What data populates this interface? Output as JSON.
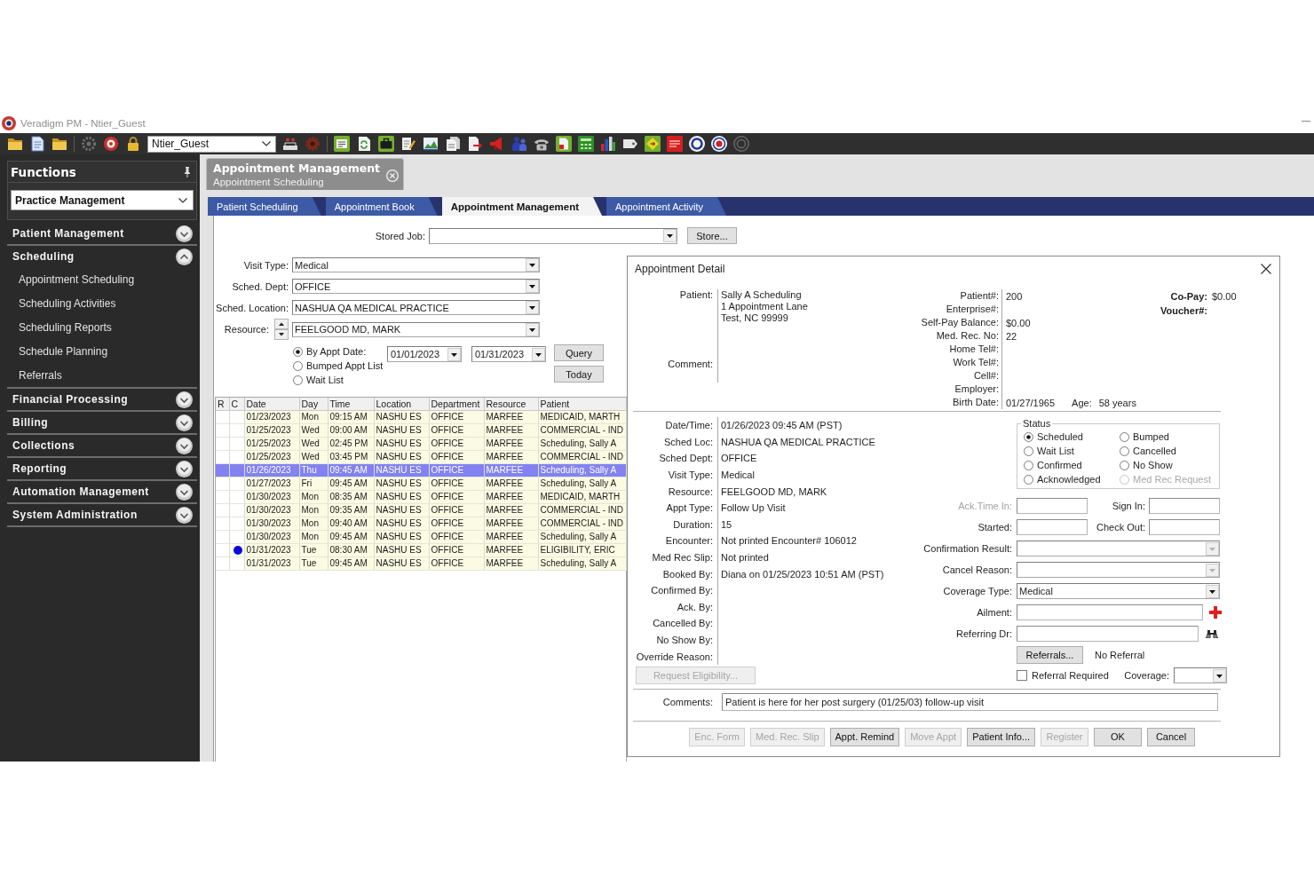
{
  "window": {
    "title": "Veradigm PM - Ntier_Guest"
  },
  "toolbar": {
    "user": "Ntier_Guest"
  },
  "sidebar": {
    "title": "Functions",
    "module": "Practice Management",
    "sections": [
      {
        "label": "Patient Management",
        "expanded": false
      },
      {
        "label": "Scheduling",
        "expanded": true,
        "items": [
          {
            "label": "Appointment Scheduling"
          },
          {
            "label": "Scheduling Activities"
          },
          {
            "label": "Scheduling Reports"
          },
          {
            "label": "Schedule Planning"
          },
          {
            "label": "Referrals"
          }
        ]
      },
      {
        "label": "Financial Processing",
        "expanded": false
      },
      {
        "label": "Billing",
        "expanded": false
      },
      {
        "label": "Collections",
        "expanded": false
      },
      {
        "label": "Reporting",
        "expanded": false
      },
      {
        "label": "Automation Management",
        "expanded": false
      },
      {
        "label": "System Administration",
        "expanded": false
      }
    ]
  },
  "document_tab": {
    "title": "Appointment Management",
    "subtitle": "Appointment Scheduling"
  },
  "tabs": [
    {
      "label": "Patient Scheduling",
      "selected": false
    },
    {
      "label": "Appointment Book",
      "selected": false
    },
    {
      "label": "Appointment Management",
      "selected": true
    },
    {
      "label": "Appointment Activity",
      "selected": false
    }
  ],
  "search_form": {
    "stored_job": {
      "label": "Stored Job:"
    },
    "store_button": "Store...",
    "fields": [
      {
        "label": "Visit Type:",
        "value": "Medical",
        "kind": "select"
      },
      {
        "label": "Sched. Dept:",
        "value": "OFFICE",
        "kind": "select"
      },
      {
        "label": "Sched. Location:",
        "value": "NASHUA QA MEDICAL PRACTICE",
        "kind": "select"
      },
      {
        "label": "Resource:",
        "value": "FEELGOOD MD, MARK",
        "kind": "spinner_select"
      }
    ],
    "modes": [
      {
        "label": "By Appt Date:",
        "selected": true
      },
      {
        "label": "Bumped Appt List",
        "selected": false
      },
      {
        "label": "Wait List",
        "selected": false
      }
    ],
    "date_from": "01/01/2023",
    "date_to": "01/31/2023",
    "buttons": [
      "Query",
      "Today"
    ]
  },
  "table": {
    "columns": [
      "R",
      "C",
      "Date",
      "Day",
      "Time",
      "Location",
      "Department",
      "Resource",
      "Patient"
    ],
    "rows": [
      {
        "date": "01/23/2023",
        "day": "Mon",
        "time": "09:15 AM",
        "location": "NASHU ES",
        "department": "OFFICE",
        "resource": "MARFEE",
        "patient": "MEDICAID, MARTH",
        "selected": false,
        "dot": false
      },
      {
        "date": "01/25/2023",
        "day": "Wed",
        "time": "09:00 AM",
        "location": "NASHU ES",
        "department": "OFFICE",
        "resource": "MARFEE",
        "patient": "COMMERCIAL - IND",
        "selected": false,
        "dot": false
      },
      {
        "date": "01/25/2023",
        "day": "Wed",
        "time": "02:45 PM",
        "location": "NASHU ES",
        "department": "OFFICE",
        "resource": "MARFEE",
        "patient": "Scheduling, Sally A",
        "selected": false,
        "dot": false
      },
      {
        "date": "01/25/2023",
        "day": "Wed",
        "time": "03:45 PM",
        "location": "NASHU ES",
        "department": "OFFICE",
        "resource": "MARFEE",
        "patient": "COMMERCIAL - IND",
        "selected": false,
        "dot": false
      },
      {
        "date": "01/26/2023",
        "day": "Thu",
        "time": "09:45 AM",
        "location": "NASHU ES",
        "department": "OFFICE",
        "resource": "MARFEE",
        "patient": "Scheduling, Sally A",
        "selected": true,
        "dot": false
      },
      {
        "date": "01/27/2023",
        "day": "Fri",
        "time": "09:45 AM",
        "location": "NASHU ES",
        "department": "OFFICE",
        "resource": "MARFEE",
        "patient": "Scheduling, Sally A",
        "selected": false,
        "dot": false
      },
      {
        "date": "01/30/2023",
        "day": "Mon",
        "time": "08:35 AM",
        "location": "NASHU ES",
        "department": "OFFICE",
        "resource": "MARFEE",
        "patient": "MEDICAID, MARTH",
        "selected": false,
        "dot": false
      },
      {
        "date": "01/30/2023",
        "day": "Mon",
        "time": "09:35 AM",
        "location": "NASHU ES",
        "department": "OFFICE",
        "resource": "MARFEE",
        "patient": "COMMERCIAL - IND",
        "selected": false,
        "dot": false
      },
      {
        "date": "01/30/2023",
        "day": "Mon",
        "time": "09:40 AM",
        "location": "NASHU ES",
        "department": "OFFICE",
        "resource": "MARFEE",
        "patient": "COMMERCIAL - IND",
        "selected": false,
        "dot": false
      },
      {
        "date": "01/30/2023",
        "day": "Mon",
        "time": "09:45 AM",
        "location": "NASHU ES",
        "department": "OFFICE",
        "resource": "MARFEE",
        "patient": "Scheduling, Sally A",
        "selected": false,
        "dot": false
      },
      {
        "date": "01/31/2023",
        "day": "Tue",
        "time": "08:30 AM",
        "location": "NASHU ES",
        "department": "OFFICE",
        "resource": "MARFEE",
        "patient": "ELIGIBILITY, ERIC",
        "selected": false,
        "dot": true
      },
      {
        "date": "01/31/2023",
        "day": "Tue",
        "time": "09:45 AM",
        "location": "NASHU ES",
        "department": "OFFICE",
        "resource": "MARFEE",
        "patient": "Scheduling, Sally A",
        "selected": false,
        "dot": false
      }
    ]
  },
  "appointment_detail": {
    "title": "Appointment Detail",
    "patient": {
      "label": "Patient:",
      "lines": [
        "Sally A Scheduling",
        "1 Appointment Lane",
        "Test, NC 99999"
      ]
    },
    "comment": {
      "label": "Comment:"
    },
    "patient_info": [
      {
        "label": "Patient#:",
        "value": "200"
      },
      {
        "label": "Enterprise#:"
      },
      {
        "label": "Self-Pay Balance:",
        "value": "$0.00"
      },
      {
        "label": "Med. Rec. No:",
        "value": "22"
      },
      {
        "label": "Home Tel#:"
      },
      {
        "label": "Work Tel#:"
      },
      {
        "label": "Cell#:"
      },
      {
        "label": "Employer:"
      },
      {
        "label": "Birth Date:",
        "value": "01/27/1965",
        "age_label": "Age:",
        "age": "58 years"
      }
    ],
    "copay": {
      "label": "Co-Pay:",
      "value": "$0.00"
    },
    "voucher": {
      "label": "Voucher#:"
    },
    "details": [
      {
        "label": "Date/Time:",
        "value": "01/26/2023 09:45 AM (PST)"
      },
      {
        "label": "Sched Loc:",
        "value": "NASHUA QA MEDICAL PRACTICE"
      },
      {
        "label": "Sched Dept:",
        "value": "OFFICE"
      },
      {
        "label": "Visit Type:",
        "value": "Medical"
      },
      {
        "label": "Resource:",
        "value": "FEELGOOD MD, MARK"
      },
      {
        "label": "Appt Type:",
        "value": "Follow Up Visit"
      },
      {
        "label": "Duration:",
        "value": "15"
      },
      {
        "label": "Encounter:",
        "value": "Not printed Encounter# 106012"
      },
      {
        "label": "Med Rec Slip:",
        "value": "Not printed"
      },
      {
        "label": "Booked By:",
        "value": "Diana on 01/25/2023 10:51 AM (PST)"
      },
      {
        "label": "Confirmed By:"
      },
      {
        "label": "Ack. By:"
      },
      {
        "label": "Cancelled By:"
      },
      {
        "label": "No Show By:"
      },
      {
        "label": "Override Reason:"
      }
    ],
    "request_eligibility": {
      "label": "Request Eligibility...",
      "disabled": true
    },
    "status": {
      "title": "Status",
      "options": [
        {
          "label": "Scheduled",
          "selected": true,
          "disabled": false
        },
        {
          "label": "Wait List",
          "selected": false,
          "disabled": false
        },
        {
          "label": "Confirmed",
          "selected": false,
          "disabled": false
        },
        {
          "label": "Acknowledged",
          "selected": false,
          "disabled": false
        },
        {
          "label": "Bumped",
          "selected": false,
          "disabled": false
        },
        {
          "label": "Cancelled",
          "selected": false,
          "disabled": false
        },
        {
          "label": "No Show",
          "selected": false,
          "disabled": false
        },
        {
          "label": "Med Rec Request",
          "selected": false,
          "disabled": true
        }
      ]
    },
    "time_fields": [
      {
        "label": "Ack.Time In:",
        "disabled": true
      },
      {
        "label": "Sign In:",
        "disabled": false
      },
      {
        "label": "Started:",
        "disabled": false
      },
      {
        "label": "Check Out:",
        "disabled": false
      }
    ],
    "selects": [
      {
        "label": "Confirmation Result:",
        "disabled": true
      },
      {
        "label": "Cancel Reason:",
        "disabled": true
      },
      {
        "label": "Coverage Type:",
        "value": "Medical",
        "disabled": false
      }
    ],
    "lookups": [
      {
        "label": "Ailment:"
      },
      {
        "label": "Referring Dr:"
      }
    ],
    "referrals": {
      "button": "Referrals...",
      "status": "No Referral"
    },
    "referral_required": {
      "label": "Referral Required",
      "checked": false
    },
    "coverage": {
      "label": "Coverage:"
    },
    "comments": {
      "label": "Comments:",
      "value": "Patient is here for her post surgery (01/25/03) follow-up visit"
    },
    "buttons": [
      {
        "label": "Enc. Form",
        "disabled": true
      },
      {
        "label": "Med. Rec. Slip",
        "disabled": true
      },
      {
        "label": "Appt. Remind",
        "disabled": false
      },
      {
        "label": "Move Appt",
        "disabled": true
      },
      {
        "label": "Patient Info...",
        "disabled": false
      },
      {
        "label": "Register",
        "disabled": true
      },
      {
        "label": "OK",
        "disabled": false
      },
      {
        "label": "Cancel",
        "disabled": false
      }
    ]
  }
}
